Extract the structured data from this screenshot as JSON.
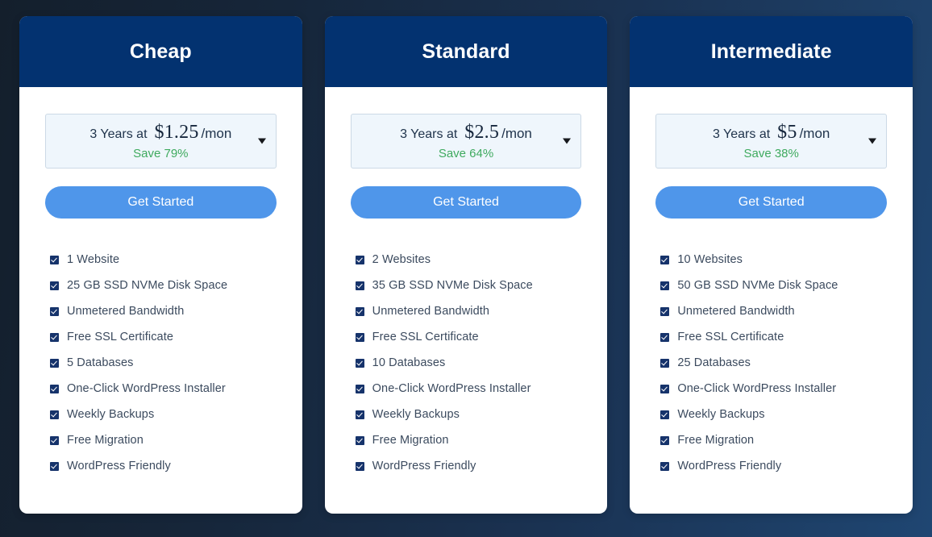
{
  "theme": {
    "page_background_start": "#141f2c",
    "page_background_end": "#1f4672",
    "header_blue": "#033270",
    "cta_blue": "#4f96ea",
    "save_green": "#3faa5f",
    "checkbox_navy": "#16336b",
    "price_box_background": "#eff6fc",
    "price_box_border": "#ccd9e6"
  },
  "plans": [
    {
      "title": "Cheap",
      "price": {
        "term": "3 Years at",
        "amount": "$1.25",
        "period": "/mon",
        "save": "Save 79%"
      },
      "cta_label": "Get Started",
      "features": [
        "1 Website",
        "25 GB SSD NVMe Disk Space",
        "Unmetered Bandwidth",
        "Free SSL Certificate",
        "5 Databases",
        "One-Click WordPress Installer",
        "Weekly Backups",
        "Free Migration",
        "WordPress Friendly"
      ]
    },
    {
      "title": "Standard",
      "price": {
        "term": "3 Years at",
        "amount": "$2.5",
        "period": "/mon",
        "save": "Save 64%"
      },
      "cta_label": "Get Started",
      "features": [
        "2 Websites",
        "35 GB SSD NVMe Disk Space",
        "Unmetered Bandwidth",
        "Free SSL Certificate",
        "10 Databases",
        "One-Click WordPress Installer",
        "Weekly Backups",
        "Free Migration",
        "WordPress Friendly"
      ]
    },
    {
      "title": "Intermediate",
      "price": {
        "term": "3 Years at",
        "amount": "$5",
        "period": "/mon",
        "save": "Save 38%"
      },
      "cta_label": "Get Started",
      "features": [
        "10 Websites",
        "50 GB SSD NVMe Disk Space",
        "Unmetered Bandwidth",
        "Free SSL Certificate",
        "25 Databases",
        "One-Click WordPress Installer",
        "Weekly Backups",
        "Free Migration",
        "WordPress Friendly"
      ]
    }
  ]
}
